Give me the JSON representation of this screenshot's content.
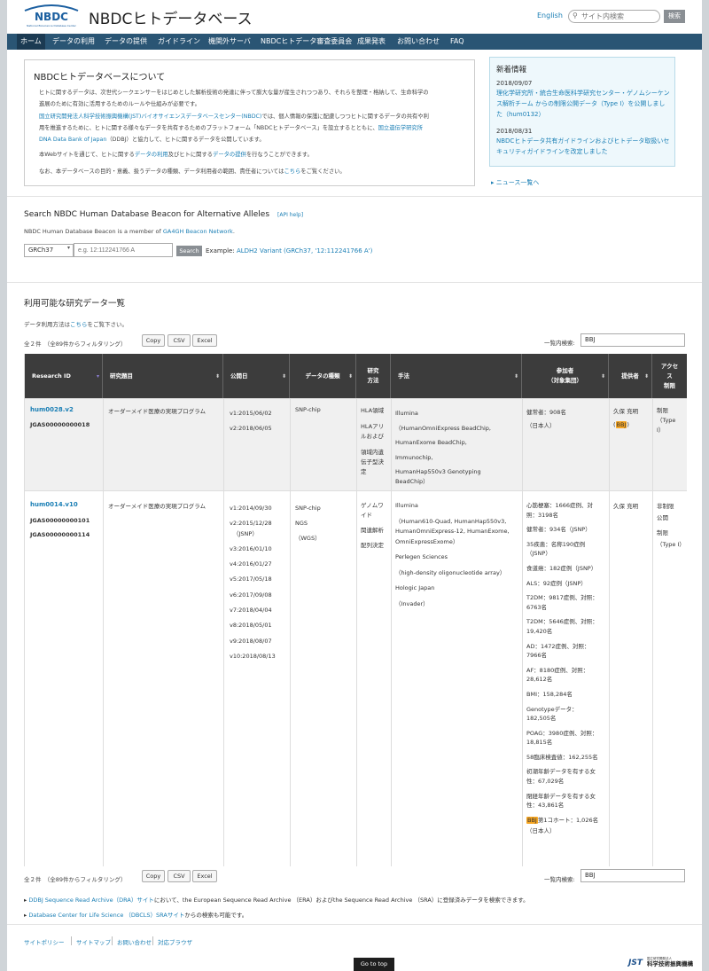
{
  "header": {
    "site_title": "NBDCヒトデータベース",
    "logo_text": "NBDC",
    "logo_subtext": "National Bioscience Database Center",
    "lang": "English",
    "search_placeholder": "サイト内検索",
    "search_button": "検索"
  },
  "nav": [
    "ホーム",
    "データの利用",
    "データの提供",
    "ガイドライン",
    "機関外サーバ",
    "NBDCヒトデータ審査委員会",
    "成果発表",
    "お問い合わせ",
    "FAQ"
  ],
  "about": {
    "title": "NBDCヒトデータベースについて",
    "p1": "ヒトに関するデータは、次世代シークエンサーをはじめとした解析技術の発達に伴って膨大な量が産生されつつあり、それらを整理・格納して、生命科学の\n進展のために有効に活用するためのルールや仕組みが必要です。",
    "p2_link1": "国立研究開発法人科学技術振興機構(JST)バイオサイエンスデータベースセンター(NBDC)",
    "p2_text1": "では、個人情報の保護に配慮しつつヒトに関するデータの共有や利\n用を推進するために、ヒトに関する様々なデータを共有するためのプラットフォーム「NBDCヒトデータベース」を設立するとともに、",
    "p2_link2": "国立遺伝学研究所\nDNA Data Bank of Japan",
    "p2_text2": "（DDBJ）と協力して、ヒトに関するデータを公開しています。",
    "p3_a": "本Webサイトを通じて、ヒトに関する",
    "p3_link1": "データの利用",
    "p3_b": "及びヒトに関する",
    "p3_link2": "データの提供",
    "p3_c": "を行なうことができます。",
    "p4_a": "なお、本データベースの目的・意義、扱うデータの種類、データ利用者の範囲、責任者については",
    "p4_link": "こちら",
    "p4_b": "をご覧ください。"
  },
  "news": {
    "title": "新着情報",
    "items": [
      {
        "date": "2018/09/07",
        "text": "理化学研究所・統合生命医科学研究センター・ゲノムシーケンス解析チーム からの制限公開データ（Type I）を公開しました（hum0132）"
      },
      {
        "date": "2018/08/31",
        "text": "NBDCヒトデータ共有ガイドラインおよびヒトデータ取扱いセキュリティガイドラインを改定しました"
      }
    ],
    "more": "ニュース一覧へ"
  },
  "beacon": {
    "title": "Search NBDC Human Database Beacon for Alternative Alleles",
    "api": "[API help]",
    "member_text": "NBDC Human Database Beacon is a member of",
    "member_link": "GA4GH Beacon Network",
    "member_end": ".",
    "ref": "GRCh37",
    "placeholder": "e.g. 12:112241766 A",
    "button": "Search",
    "example_label": "Example:",
    "example_link": "ALDH2 Variant (GRCh37, '12:112241766 A')"
  },
  "list": {
    "title": "利用可能な研究データ一覧",
    "note_a": "データ利用方法は",
    "note_link": "こちら",
    "note_b": "をご覧下さい。",
    "count": "全２件　（全89件からフィルタリング）",
    "copy": "Copy",
    "csv": "CSV",
    "excel": "Excel",
    "filter_label": "一覧内検索:",
    "filter_value": "BBJ"
  },
  "table": {
    "headers": [
      "Research ID",
      "研究題目",
      "公開日",
      "データの種類",
      "研究\n方法",
      "手法",
      "参加者\n（対象集団）",
      "提供者",
      "アクセ\nス\n制限"
    ],
    "rows": [
      {
        "id": "hum0028.v2",
        "jgas": [
          "JGAS00000000018"
        ],
        "title": "オーダーメイド医療の実現プログラム",
        "dates": [
          "v1:2015/06/02",
          "v2:2018/06/05"
        ],
        "types": [
          "SNP-chip"
        ],
        "methods": [
          "HLA領域",
          "HLAアリ",
          "ルおよび",
          "",
          "領域内遺",
          "伝子型決",
          "定"
        ],
        "techniques": [
          "Illumina",
          "（HumanOmniExpress BeadChip,",
          "HumanExome BeadChip,",
          "Immunochip,",
          "HumanHap550v3 Genotyping",
          "BeadChip）"
        ],
        "participants": [
          "健常者：908名",
          "（日本人）"
        ],
        "provider": "久保 充明",
        "provider_tag": "BBJ",
        "access": [
          "制限",
          "（Type",
          "I）"
        ]
      },
      {
        "id": "hum0014.v10",
        "jgas": [
          "JGAS00000000101",
          "JGAS00000000114"
        ],
        "title": "オーダーメイド医療の実現プログラム",
        "dates": [
          "v1:2014/09/30",
          "v2:2015/12/28",
          "（JSNP）",
          "v3:2016/01/10",
          "v4:2016/01/27",
          "v5:2017/05/18",
          "v6:2017/09/08",
          "v7:2018/04/04",
          "v8:2018/05/01",
          "v9:2018/08/07",
          "v10:2018/08/13"
        ],
        "types": [
          "SNP-chip",
          "NGS",
          "（WGS）"
        ],
        "methods": [
          "ゲノムワ",
          "イド",
          "関連解析",
          "配列決定"
        ],
        "techniques": [
          "Illumina",
          "（Human610-Quad, HumanHap550v3,",
          "HumanOmniExpress-12, HumanExome,",
          "OmniExpressExome）",
          "Perlegen Sciences",
          "（high-density oligonucleotide array）",
          "Hologic Japan",
          "（Invader）"
        ],
        "participants": [
          "心筋梗塞：1666症例、対",
          "照：3198名",
          "健常者：934名（JSNP）",
          "35疾患：名称190症例",
          "（JSNP）",
          "食道癌：182症例（JSNP）",
          "ALS：92症例（JSNP）",
          "T2DM：9817症例、対照：",
          "6763名",
          "T2DM：5646症例、対照：",
          "19,420名",
          "AD：1472症例、対照：",
          "7966名",
          "AF：8180症例、対照：",
          "28,612名",
          "BMI：158,284名",
          "Genotypeデータ：",
          "182,505名",
          "POAG：3980症例、対照：",
          "18,815名",
          "58臨床検査値：162,255名",
          "初潮年齢データを有する女",
          "性：67,029名",
          "閉経年齢データを有する女",
          "性：43,861名",
          "第1コホート：1,026名",
          "（日本人）"
        ],
        "participants_tag": "BBJ",
        "provider": "久保 充明",
        "access": [
          "非制限",
          "公開",
          "制限",
          "（Type I）"
        ]
      }
    ]
  },
  "footer": {
    "links": [
      {
        "link": "DDBJ Sequence Read Archive（DRA）サイト",
        "text": "において、the European Sequence Read Archive （ERA）およびthe Sequence Read Archive （SRA）に登録済みデータを検索できます。"
      },
      {
        "link": "Database Center for Life Science （DBCLS）SRAサイト",
        "text": "からの検索も可能です。"
      }
    ],
    "nav": [
      "サイトポリシー",
      "サイトマップ",
      "お問い合わせ",
      "対応ブラウザ"
    ],
    "gotop": "Go to top",
    "jst": "科学技術振興機構",
    "jst_small": "国立研究開発法人"
  },
  "colors": {
    "nav_bg": "#2a5574",
    "link": "#1b7fb5",
    "table_header": "#3c3c3c",
    "highlight": "#f6a623"
  }
}
